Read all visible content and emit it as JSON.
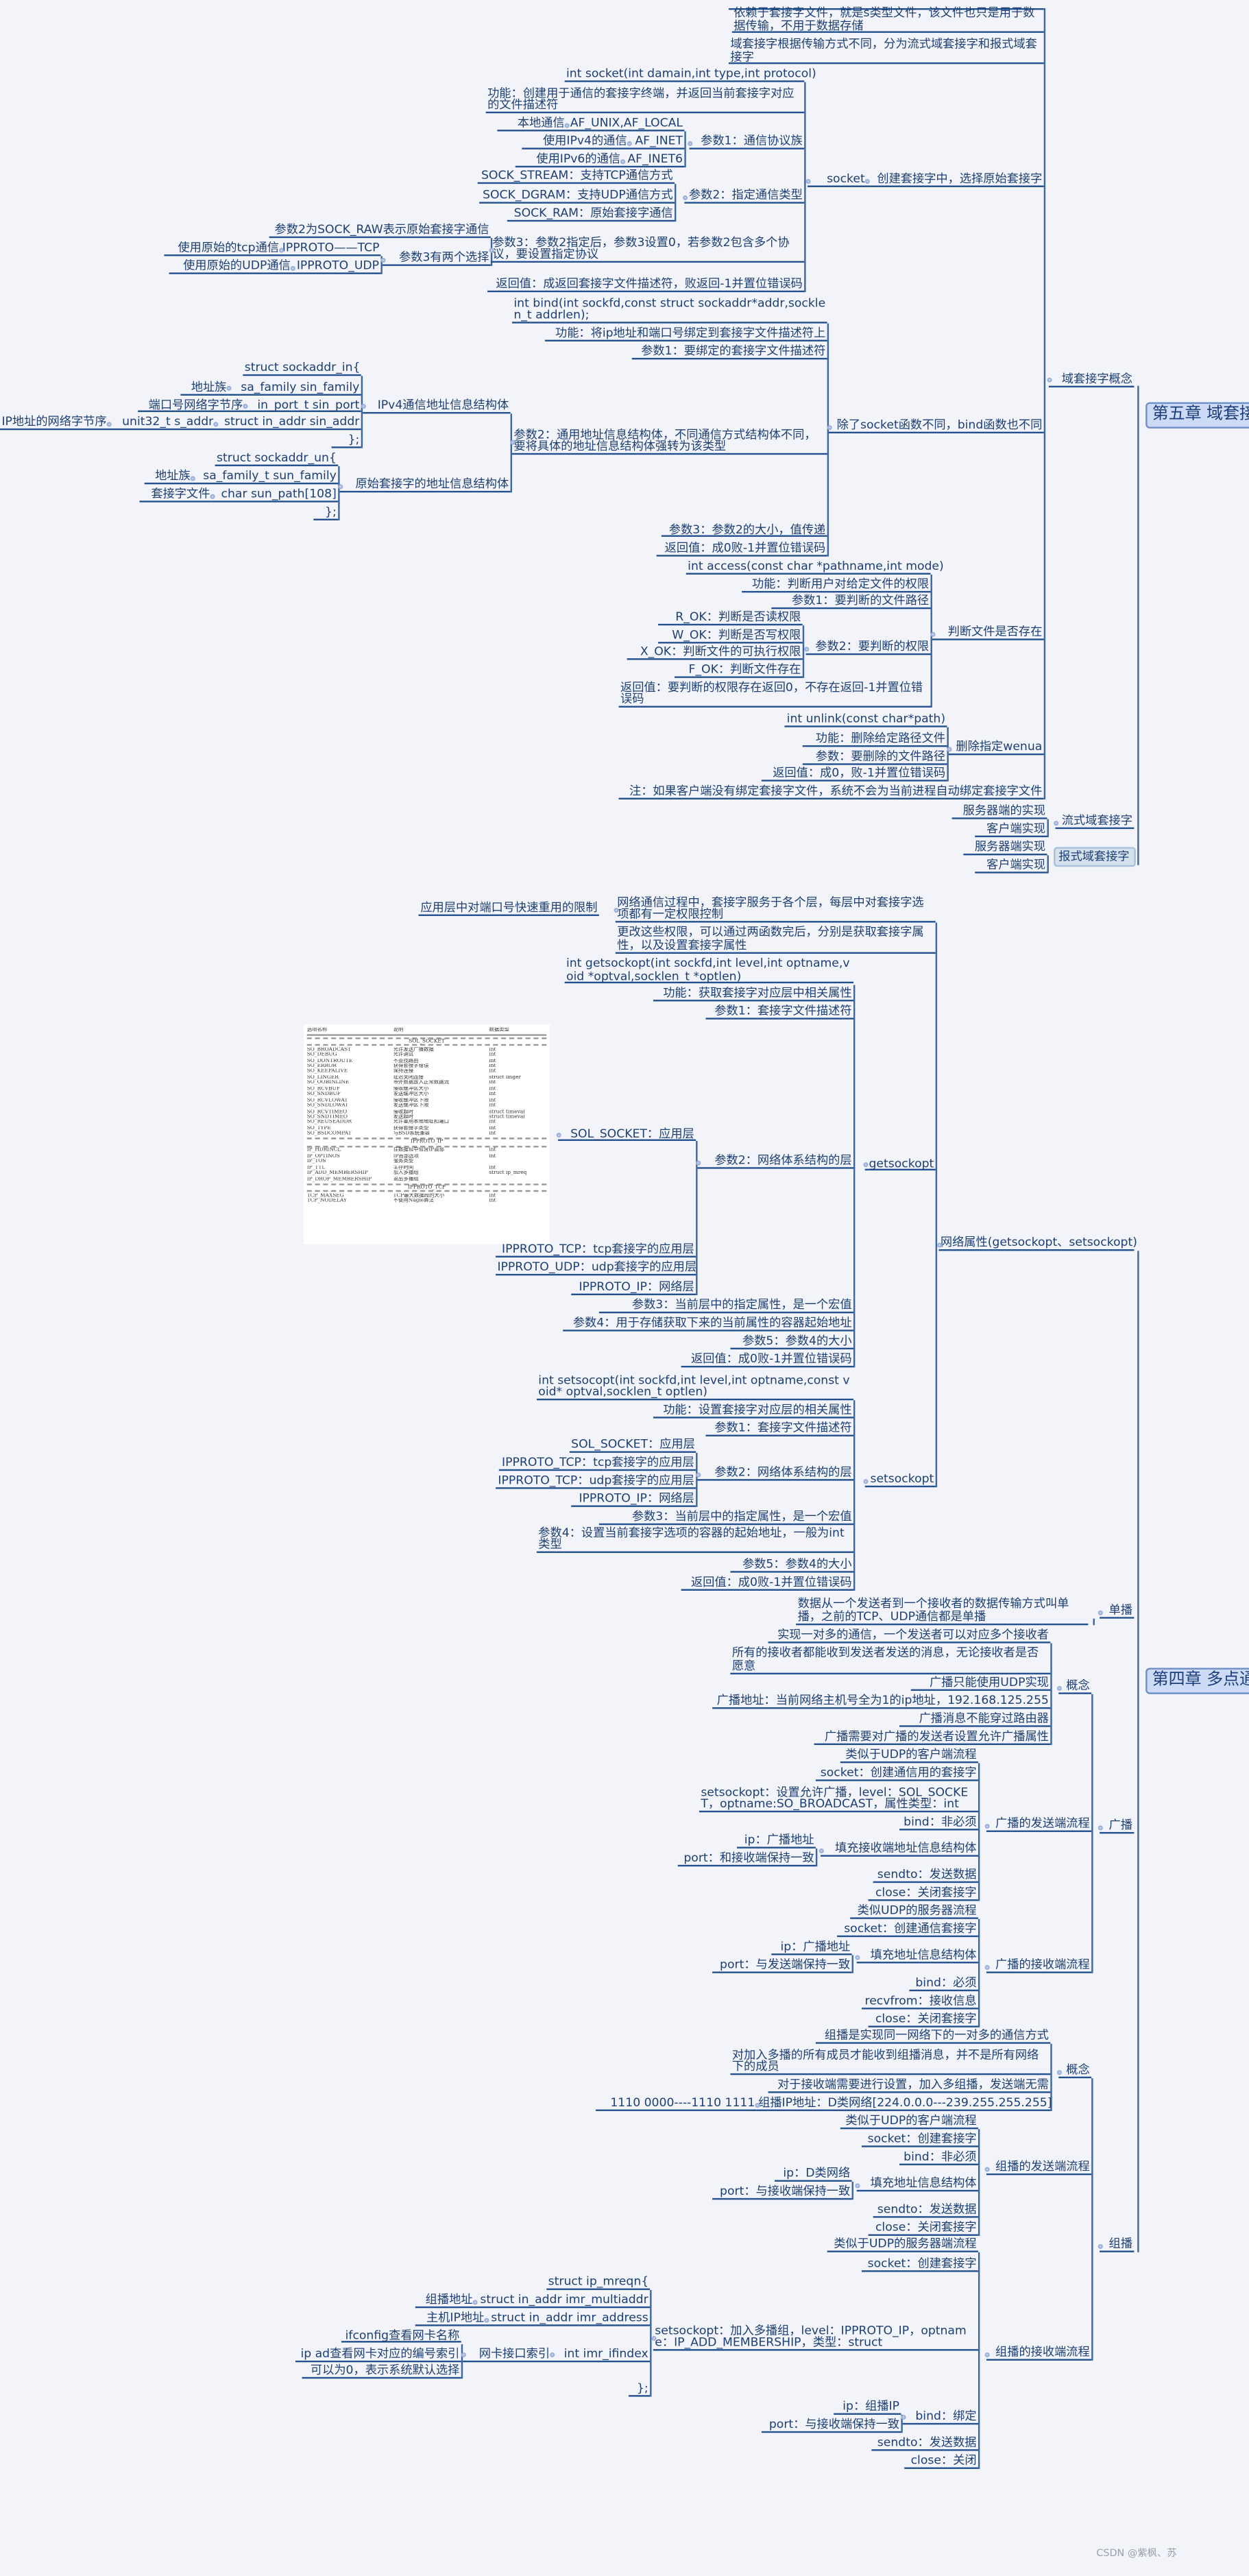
{
  "chapter5": {
    "title": "第五章 域套接字",
    "dgram_box": "报式域套接字",
    "topics": {
      "concept": "域套接字概念",
      "stream": "流式域套接字",
      "a1": "依赖于套接字文件，就是s类型文件，该文件也只是用于数据传输，不用于数据存储",
      "a2": "域套接字根据传输方式不同，分为流式域套接字和报式域套接字",
      "a3": "创建套接字中，选择原始套接字",
      "socket": "socket",
      "b1": "int socket(int damain,int type,int protocol)",
      "b2": "功能：创建用于通信的套接字终端，并返回当前套接字对应的文件描述符",
      "b3": "参数1：通信协议族",
      "c1": "AF_UNIX,AF_LOCAL",
      "c1_label": "本地通信",
      "c2": "AF_INET",
      "c2_label": "使用IPv4的通信",
      "c3": "AF_INET6",
      "c3_label": "使用IPv6的通信",
      "b4": "参数2：指定通信类型",
      "c4": "SOCK_STREAM：支持TCP通信方式",
      "c5": "SOCK_DGRAM：支持UDP通信方式",
      "c6": "SOCK_RAM：原始套接字通信",
      "b5": "参数3：参数2指定后，参数3设置0，若参数2包含多个协议，要设置指定协议",
      "c7": "参数2为SOCK_RAW表示原始套接字通信",
      "c8": "参数3有两个选择",
      "d1": "IPPROTO——TCP",
      "d1_label": "使用原始的tcp通信",
      "d2": "IPPROTO_UDP",
      "d2_label": "使用原始的UDP通信",
      "b6": "返回值：成返回套接字文件描述符，败返回-1并置位错误码",
      "bind_parent": "除了socket函数不同，bind函数也不同",
      "e1": "int bind(int sockfd,const struct sockaddr*addr,socklen_t addrlen);",
      "e2": "功能：将ip地址和端口号绑定到套接字文件描述符上",
      "e3": "参数1：要绑定的套接字文件描述符",
      "e4": "参数2：通用地址信息结构体，不同通信方式结构体不同，要将具体的地址信息结构体强转为该类型",
      "f1": "IPv4通信地址信息结构体",
      "g1": "struct sockaddr_in{",
      "g2": "sa_family sin_family",
      "g2_label": "地址族",
      "g3": "in_port_t sin_port",
      "g3_label": "端口号网络字节序",
      "g4": "struct in_addr sin_addr",
      "g4_sub": "unit32_t s_addr",
      "g4_label": "IP地址的网络字节序",
      "g5": "};",
      "f2": "原始套接字的地址信息结构体",
      "g6": "struct sockaddr_un{",
      "g7": "sa_family_t sun_family",
      "g7_label": "地址族",
      "g8": "char sun_path[108]",
      "g8_label": "套接字文件",
      "g9": "};",
      "e5": "参数3：参数2的大小，值传递",
      "e6": "返回值：成0败-1并置位错误码",
      "access_parent": "判断文件是否存在",
      "h1": "int access(const char *pathname,int mode)",
      "h2": "功能：判断用户对给定文件的权限",
      "h3": "参数1：要判断的文件路径",
      "h4": "参数2：要判断的权限",
      "i1": "R_OK：判断是否读权限",
      "i2": "W_OK：判断是否写权限",
      "i3": "X_OK：判断文件的可执行权限",
      "i4": "F_OK：判断文件存在",
      "h5": "返回值：要判断的权限存在返回0，不存在返回-1并置位错误码",
      "unlink_parent": "删除指定wenua",
      "j1": "int unlink(const char*path)",
      "j2": "功能：删除给定路径文件",
      "j3": "参数：要删除的文件路径",
      "j4": "返回值：成0，败-1并置位错误码",
      "k1": "注：如果客户端没有绑定套接字文件，系统不会为当前进程自动绑定套接字文件",
      "stream_server": "服务器端的实现",
      "stream_client": "客户端实现",
      "dgram_server": "服务器端实现",
      "dgram_client": "客户端实现"
    }
  },
  "chapter4": {
    "title": "第四章 多点通信",
    "topics": {
      "netattr": "网络属性(getsockopt、setsockopt)",
      "l1": "网络通信过程中，套接字服务于各个层，每层中对套接字选项都有一定权限控制",
      "l1_label": "应用层中对端口号快速重用的限制",
      "l2": "更改这些权限，可以通过两函数完后，分别是获取套接字属性，以及设置套接字属性",
      "getsockopt": "getsockopt",
      "m1": "int getsockopt(int sockfd,int level,int optname,void *optval,socklen_t *optlen)",
      "m2": "功能：获取套接字对应层中相关属性",
      "m3": "参数1：套接字文件描述符",
      "m4": "参数2：网络体系结构的层",
      "n1": "SOL_SOCKET：应用层",
      "n2": "IPPROTO_TCP：tcp套接字的应用层",
      "n3": "IPPROTO_UDP：udp套接字的应用层",
      "n4": "IPPROTO_IP：网络层",
      "m5": "参数3：当前层中的指定属性，是一个宏值",
      "m6": "参数4：用于存储获取下来的当前属性的容器起始地址",
      "m7": "参数5：参数4的大小",
      "m8": "返回值：成0败-1并置位错误码",
      "setsockopt": "setsockopt",
      "o1": "int setsocopt(int sockfd,int level,int optname,const void* optval,socklen_t optlen)",
      "o2": "功能：设置套接字对应层的相关属性",
      "o3": "参数1：套接字文件描述符",
      "o4": "参数2：网络体系结构的层",
      "p1": "SOL_SOCKET：应用层",
      "p2": "IPPROTO_TCP：tcp套接字的应用层",
      "p3": "IPPROTO_TCP：udp套接字的应用层",
      "p4": "IPPROTO_IP：网络层",
      "o5": "参数3：当前层中的指定属性，是一个宏值",
      "o6": "参数4：设置当前套接字选项的容器的起始地址，一般为int类型",
      "o7": "参数5：参数4的大小",
      "o8": "返回值：成0败-1并置位错误码",
      "unicast": "单播",
      "u_desc": "数据从一个发送者到一个接收者的数据传输方式叫单播，之前的TCP、UDP通信都是单播",
      "broadcast": "广播",
      "bc_concept": "概念",
      "q1": "实现一对多的通信，一个发送者可以对应多个接收者",
      "q2": "所有的接收者都能收到发送者发送的消息，无论接收者是否愿意",
      "q3": "广播只能使用UDP实现",
      "q4": "广播地址：当前网络主机号全为1的ip地址，192.168.125.255",
      "q5": "广播消息不能穿过路由器",
      "q6": "广播需要对广播的发送者设置允许广播属性",
      "bc_send": "广播的发送端流程",
      "r1": "类似于UDP的客户端流程",
      "r2": "socket：创建通信用的套接字",
      "r3": "setsockopt：设置允许广播，level：SOL_SOCKET，optname:SO_BROADCAST，属性类型：int",
      "r4": "bind：非必须",
      "r5": "填充接收端地址信息结构体",
      "s1": "ip：广播地址",
      "s2": "port：和接收端保持一致",
      "r6": "sendto：发送数据",
      "r7": "close：关闭套接字",
      "bc_recv": "广播的接收端流程",
      "t1": "类似UDP的服务器流程",
      "t2": "socket：创建通信套接字",
      "t3": "填充地址信息结构体",
      "u1": "ip：广播地址",
      "u2": "port：与发送端保持一致",
      "t4": "bind：必须",
      "t5": "recvfrom：接收信息",
      "t6": "close：关闭套接字",
      "multicast": "组播",
      "mc_concept": "概念",
      "v1": "组播是实现同一网络下的一对多的通信方式",
      "v2": "对加入多播的所有成员才能收到组播消息，并不是所有网络下的成员",
      "v3": "对于接收端需要进行设置，加入多组播，发送端无需",
      "v4": "组播IP地址：D类网络[224.0.0.0---239.255.255.255]",
      "v4_label": "1110 0000----1110 1111",
      "mc_send": "组播的发送端流程",
      "w1": "类似于UDP的客户端流程",
      "w2": "socket：创建套接字",
      "w3": "bind：非必须",
      "w4": "填充地址信息结构体",
      "x1": "ip：D类网络",
      "x2": "port：与接收端保持一致",
      "w5": "sendto：发送数据",
      "w6": "close：关闭套接字",
      "mc_recv": "组播的接收端流程",
      "y1": "类似于UDP的服务器端流程",
      "y2": "socket：创建套接字",
      "y3": "setsockopt：加入多播组，level：IPPROTO_IP，optname：IP_ADD_MEMBERSHIP，类型：struct",
      "z1": "struct ip_mreqn{",
      "z2": "struct in_addr imr_multiaddr",
      "z2_label": "组播地址",
      "z3": "struct in_addr imr_address",
      "z3_label": "主机IP地址",
      "z4": "int imr_ifindex",
      "z4_sub": "网卡接口索引",
      "zz1": "ifconfig查看网卡名称",
      "zz2": "ip ad查看网卡对应的编号索引",
      "zz3": "可以为0，表示系统默认选择",
      "z5": "};",
      "y4": "bind：绑定",
      "y4a": "ip：组播IP",
      "y4b": "port：与接收端保持一致",
      "y5": "sendto：发送数据",
      "y6": "close：关闭"
    }
  },
  "option_table": {
    "headers": [
      "选项名称",
      "说明",
      "数据类型"
    ],
    "sections": [
      {
        "name": "SOL_SOCKET",
        "rows": [
          [
            "SO_BROADCAST",
            "允许发送广播数据",
            "int"
          ],
          [
            "SO_DEBUG",
            "允许调试",
            "int"
          ],
          [
            "SO_DONTROUTE",
            "不查找路由",
            "int"
          ],
          [
            "SO_ERROR",
            "获得套接字错误",
            "int"
          ],
          [
            "SO_KEEPALIVE",
            "保持连接",
            "int"
          ],
          [
            "SO_LINGER",
            "延迟关闭连接",
            "struct linger"
          ],
          [
            "SO_OOBINLINE",
            "带外数据放入正常数据流",
            "int"
          ],
          [
            "SO_RCVBUF",
            "接收缓冲区大小",
            "int"
          ],
          [
            "SO_SNDBUF",
            "发送缓冲区大小",
            "int"
          ],
          [
            "SO_RCVLOWAT",
            "接收缓冲区下限",
            "int"
          ],
          [
            "SO_SNDLOWAT",
            "发送缓冲区下限",
            "int"
          ],
          [
            "SO_RCVTIMEO",
            "接收超时",
            "struct timeval"
          ],
          [
            "SO_SNDTIMEO",
            "发送超时",
            "struct timeval"
          ],
          [
            "SO_REUSEADDR",
            "允许重用本地地址和端口",
            "int"
          ],
          [
            "SO_TYPE",
            "获得套接字类型",
            "int"
          ],
          [
            "SO_BSDCOMPAT",
            "与BSD系统兼容",
            "int"
          ]
        ]
      },
      {
        "name": "IPPROTO_IP",
        "rows": [
          [
            "IP_HDRINCL",
            "在数据包中包含IP首部",
            "int"
          ],
          [
            "IP_OPTINOS",
            "IP首部选项",
            "int"
          ],
          [
            "IP_TOS",
            "服务类型",
            ""
          ],
          [
            "IP_TTL",
            "生存时间",
            "int"
          ],
          [
            "IP_ADD_MEMBERSHIP",
            "加入多播组",
            "struct ip_mreq"
          ],
          [
            "IP_DROP_MEMBERSHIP",
            "退出多播组",
            ""
          ]
        ]
      },
      {
        "name": "IPPROTO_TCP",
        "rows": [
          [
            "TCP_MAXSEG",
            "TCP最大数据段的大小",
            "int"
          ],
          [
            "TCP_NODELAY",
            "不使用Nagle算法",
            "int"
          ]
        ]
      }
    ]
  },
  "watermark": "CSDN @紫枫、苏",
  "colors": {
    "background": "#f2f4f9",
    "line": "#23508e",
    "text": "#1d3f74",
    "chapter_fill": "#cddbf6"
  }
}
